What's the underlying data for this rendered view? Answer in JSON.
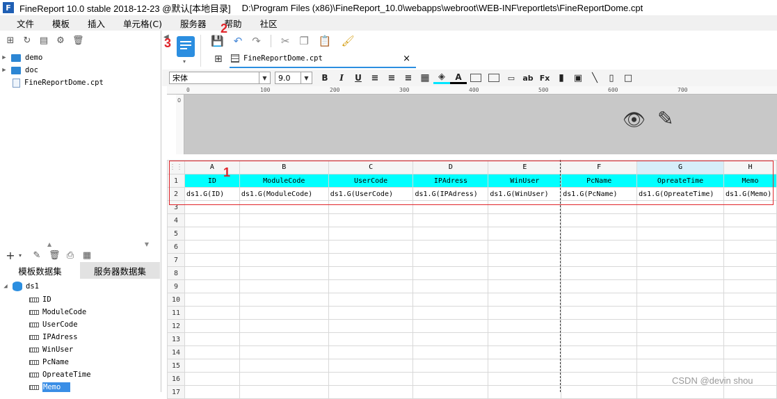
{
  "window": {
    "title": "FineReport 10.0 stable 2018-12-23 @默认[本地目录]",
    "path": "D:\\Program Files (x86)\\FineReport_10.0\\webapps\\webroot\\WEB-INF\\reportlets\\FineReportDome.cpt"
  },
  "menu": [
    "文件",
    "模板",
    "插入",
    "单元格(C)",
    "服务器",
    "帮助",
    "社区"
  ],
  "file_tree": {
    "items": [
      {
        "label": "demo",
        "type": "folder"
      },
      {
        "label": "doc",
        "type": "folder"
      },
      {
        "label": "FineReportDome.cpt",
        "type": "file"
      }
    ]
  },
  "dataset_tabs": [
    "模板数据集",
    "服务器数据集"
  ],
  "dataset": {
    "name": "ds1",
    "fields": [
      "ID",
      "ModuleCode",
      "UserCode",
      "IPAdress",
      "WinUser",
      "PcName",
      "OpreateTime",
      "Memo"
    ],
    "selected": "Memo"
  },
  "doc_tab": {
    "label": "FineReportDome.cpt"
  },
  "format": {
    "font": "宋体",
    "size": "9.0"
  },
  "ruler_ticks": [
    "0",
    "100",
    "200",
    "300",
    "400",
    "500",
    "600",
    "700"
  ],
  "vruler_label": "0",
  "grid": {
    "columns": [
      "A",
      "B",
      "C",
      "D",
      "E",
      "F",
      "G",
      "H"
    ],
    "header_row": [
      "ID",
      "ModuleCode",
      "UserCode",
      "IPAdress",
      "WinUser",
      "PcName",
      "OpreateTime",
      "Memo"
    ],
    "data_row": [
      "ds1.G(ID)",
      "ds1.G(ModuleCode)",
      "ds1.G(UserCode)",
      "ds1.G(IPAdress)",
      "ds1.G(WinUser)",
      "ds1.G(PcName)",
      "ds1.G(OpreateTime)",
      "ds1.G(Memo)"
    ],
    "row_numbers": [
      "1",
      "2",
      "3",
      "4",
      "5",
      "6",
      "7",
      "8",
      "9",
      "10",
      "11",
      "12",
      "13",
      "14",
      "15",
      "16",
      "17"
    ]
  },
  "annotations": [
    "1",
    "2",
    "3"
  ],
  "watermark": "CSDN @devin shou",
  "colors": {
    "accent": "#2b8ee0",
    "header_fill": "#00ffff",
    "annotation": "#e0242a"
  }
}
